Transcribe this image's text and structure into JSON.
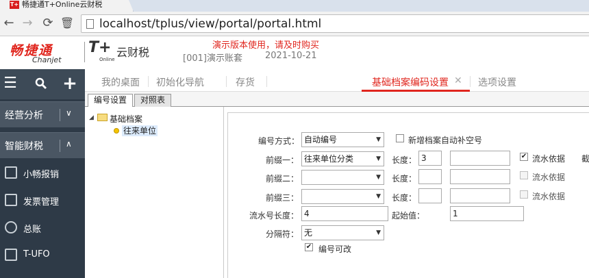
{
  "browser": {
    "tab_title": "畅捷通T+Online云财税",
    "favicon_text": "T+",
    "url": "localhost/tplus/view/portal/portal.html"
  },
  "header": {
    "brand_cn": "畅捷通",
    "brand_en": "Chanjet",
    "product_t": "T+",
    "product_online": "Online",
    "product_name": "云财税",
    "demo_notice": "演示版本使用，请及时购买",
    "account": "[001]演示账套",
    "date": "2021-10-21"
  },
  "sidebar": {
    "sections": [
      {
        "label": "经营分析",
        "chevron": "∨"
      },
      {
        "label": "智能财税",
        "chevron": "∧"
      }
    ],
    "items": [
      {
        "label": "小畅报销",
        "icon": "grid-icon"
      },
      {
        "label": "发票管理",
        "icon": "invoice-icon"
      },
      {
        "label": "总账",
        "icon": "ledger-icon"
      },
      {
        "label": "T-UFO",
        "icon": "report-icon"
      }
    ]
  },
  "main_tabs": [
    {
      "label": "我的桌面"
    },
    {
      "label": "初始化导航"
    },
    {
      "label": "存货"
    },
    {
      "label": "基础档案编码设置",
      "active": true
    },
    {
      "label": "选项设置"
    }
  ],
  "sub_tabs": [
    {
      "label": "编号设置",
      "active": true
    },
    {
      "label": "对照表"
    }
  ],
  "tree": {
    "root": "基础档案",
    "child": "往来单位"
  },
  "form": {
    "numbering_method_label": "编号方式：",
    "numbering_method_value": "自动编号",
    "auto_fill_label": "新增档案自动补空号",
    "prefix1_label": "前缀一：",
    "prefix1_value": "往来单位分类",
    "prefix2_label": "前缀二：",
    "prefix3_label": "前缀三：",
    "length_label": "长度：",
    "prefix1_length": "3",
    "serial_basis_label": "流水依据",
    "truncate_label": "截",
    "serial_length_label": "流水号长度：",
    "serial_length_value": "4",
    "start_value_label": "起始值：",
    "start_value": "1",
    "separator_label": "分隔符：",
    "separator_value": "无",
    "editable_label": "编号可改"
  },
  "colors": {
    "brand_red": "#e0261e",
    "sidebar_bg": "#2e3a47"
  }
}
